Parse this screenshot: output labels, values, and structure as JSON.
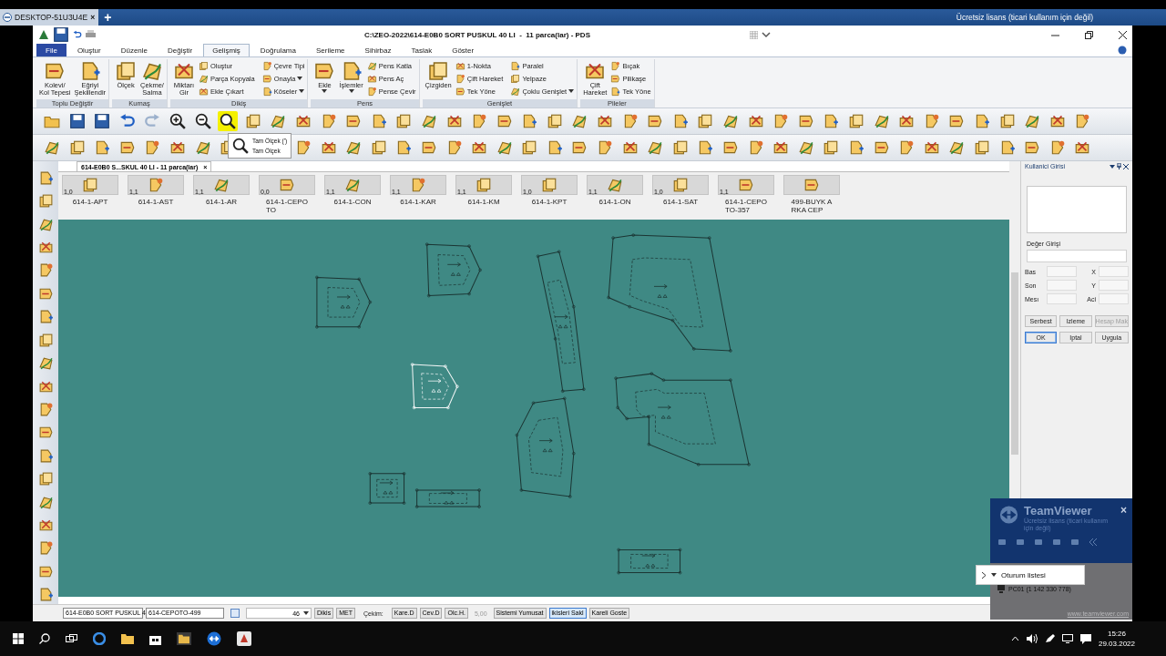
{
  "remote_tab": {
    "title": "DESKTOP-51U3U4E",
    "close": "×",
    "new_tab": "+",
    "license": "Ücretsiz lisans (ticari kullanım için değil)"
  },
  "window": {
    "title": "C:\\ZEO-2022\\614-E0B0 SORT PUSKUL 40 LI  -  11 parca(lar) - PDS"
  },
  "menu_tabs": [
    {
      "label": "File",
      "selected": false,
      "kind": "file"
    },
    {
      "label": "Oluştur",
      "selected": false,
      "kind": "tab"
    },
    {
      "label": "Düzenle",
      "selected": false,
      "kind": "tab"
    },
    {
      "label": "Değiştir",
      "selected": false,
      "kind": "tab"
    },
    {
      "label": "Gelişmiş",
      "selected": true,
      "kind": "tab"
    },
    {
      "label": "Doğrulama",
      "selected": false,
      "kind": "tab"
    },
    {
      "label": "Serileme",
      "selected": false,
      "kind": "tab"
    },
    {
      "label": "Sihirbaz",
      "selected": false,
      "kind": "tab"
    },
    {
      "label": "Taslak",
      "selected": false,
      "kind": "tab"
    },
    {
      "label": "Göster",
      "selected": false,
      "kind": "tab"
    }
  ],
  "ribbon_groups": [
    {
      "title": "Toplu Değiştir",
      "large": [
        {
          "label": "Kolevi/\nKol Tepesi",
          "menu": false
        },
        {
          "label": "Eğriyi\nŞekillendir",
          "menu": false
        }
      ]
    },
    {
      "title": "Kumaş",
      "large": [
        {
          "label": "Ölçek",
          "menu": false
        },
        {
          "label": "Çekme/\nSalma",
          "menu": false
        }
      ]
    },
    {
      "title": "Dikiş",
      "large": [
        {
          "label": "Miktarı\nGir",
          "menu": false
        }
      ],
      "small": [
        {
          "label": "Oluştur",
          "menu": false
        },
        {
          "label": "Parça Kopyala",
          "menu": false
        },
        {
          "label": "Ekle Çıkart",
          "menu": false
        },
        {
          "label": "Çevre Tipi",
          "menu": false
        },
        {
          "label": "Onayla",
          "menu": true
        },
        {
          "label": "Köseler",
          "menu": true
        }
      ]
    },
    {
      "title": "Pens",
      "large": [
        {
          "label": "Ekle",
          "menu": true
        },
        {
          "label": "İşlemler",
          "menu": true
        }
      ],
      "small": [
        {
          "label": "Pens Katla",
          "menu": false
        },
        {
          "label": "Pens Aç",
          "menu": false
        },
        {
          "label": "Pense Çevir",
          "menu": false
        }
      ]
    },
    {
      "title": "Genişlet",
      "large": [
        {
          "label": "Çizgiden",
          "menu": false
        }
      ],
      "small": [
        {
          "label": "1-Nokta",
          "menu": false
        },
        {
          "label": "Çift Hareket",
          "menu": false
        },
        {
          "label": "Tek Yöne",
          "menu": false
        },
        {
          "label": "Paralel",
          "menu": false
        },
        {
          "label": "Yelpaze",
          "menu": false
        },
        {
          "label": "Çoklu Genişlet",
          "menu": true
        }
      ]
    },
    {
      "title": "Pileler",
      "large": [
        {
          "label": "Çift\nHareket",
          "menu": false
        }
      ],
      "small": [
        {
          "label": "Bıçak",
          "menu": false
        },
        {
          "label": "Pilikaşe",
          "menu": false
        },
        {
          "label": "Tek Yöne",
          "menu": false
        }
      ]
    }
  ],
  "tooltip": {
    "lines": [
      "Tam Ölçek (')",
      "Tam Ölçek"
    ]
  },
  "doc_tab": {
    "label": "614-E0B0 S...SKUL 40 LI  -  11 parca(lar)",
    "close": "×"
  },
  "pieces": [
    {
      "name": "614-1-APT",
      "value": "1,0"
    },
    {
      "name": "614-1-AST",
      "value": "1,1"
    },
    {
      "name": "614-1-AR",
      "value": "1,1"
    },
    {
      "name": "614-1-CEPO\nTO",
      "value": "0,0"
    },
    {
      "name": "614-1-CON",
      "value": "1,1"
    },
    {
      "name": "614-1-KAR",
      "value": "1,1"
    },
    {
      "name": "614-1-KM",
      "value": "1,1"
    },
    {
      "name": "614-1-KPT",
      "value": "1,0"
    },
    {
      "name": "614-1-ON",
      "value": "1,1"
    },
    {
      "name": "614-1-SAT",
      "value": "1,0"
    },
    {
      "name": "614-1-CEPO\nTO-357",
      "value": "1,1"
    },
    {
      "name": "499-BUYK A\nRKA CEP"
    }
  ],
  "user_panel": {
    "title": "Kullanici Girisi",
    "value_label": "Değer Girişi",
    "rows": [
      {
        "left": "Bas",
        "right": "X"
      },
      {
        "left": "Son",
        "right": "Y"
      },
      {
        "left": "Mesı",
        "right": "Aci"
      }
    ],
    "buttons": [
      {
        "label": "Serbest",
        "disabled": false,
        "selected": false
      },
      {
        "label": "Izleme",
        "disabled": false,
        "selected": false
      },
      {
        "label": "Hesap Mak",
        "disabled": true,
        "selected": false
      },
      {
        "label": "OK",
        "disabled": false,
        "selected": true
      },
      {
        "label": "Iptal",
        "disabled": false,
        "selected": false
      },
      {
        "label": "Uygula",
        "disabled": false,
        "selected": false
      }
    ]
  },
  "status_bar": [
    {
      "kind": "field",
      "text": "614-E0B0 SORT PUSKUL 4"
    },
    {
      "kind": "field",
      "text": "614-CEPOTO-499"
    },
    {
      "kind": "browse"
    },
    {
      "kind": "combo",
      "text": "46"
    },
    {
      "kind": "button",
      "text": "Dikis",
      "selected": false
    },
    {
      "kind": "button",
      "text": "MET",
      "selected": false
    },
    {
      "kind": "label",
      "text": "Çekim:"
    },
    {
      "kind": "button",
      "text": "Kare.D",
      "selected": false
    },
    {
      "kind": "button",
      "text": "Cev.D",
      "selected": false
    },
    {
      "kind": "button",
      "text": "Olc.H.",
      "selected": false
    },
    {
      "kind": "value",
      "text": "5,00"
    },
    {
      "kind": "button",
      "text": "Sistemi Yumusat",
      "selected": false
    },
    {
      "kind": "button",
      "text": "ikisleri Sakl",
      "selected": true
    },
    {
      "kind": "button",
      "text": "Kareli Goste",
      "selected": false
    }
  ],
  "teamviewer": {
    "title": "TeamViewer",
    "subtitle": "Ücretsiz lisans (ticari kullanım için değil)",
    "close": "×",
    "session_menu": "Oturum listesi",
    "session": "PC01 (1 142 330 778)",
    "link": "www.teamviewer.com"
  },
  "taskbar": {
    "time": "15:26",
    "date": "29.03.2022"
  }
}
